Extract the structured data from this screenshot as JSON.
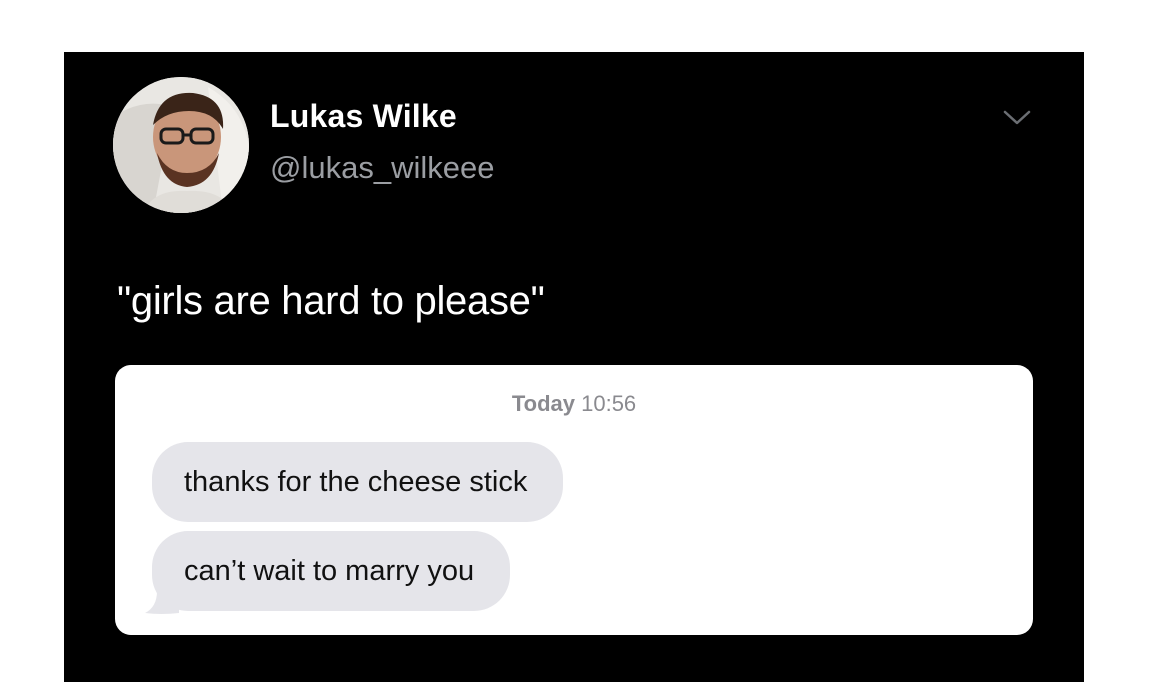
{
  "tweet": {
    "author": {
      "display_name": "Lukas Wilke",
      "handle": "@lukas_wilkeee"
    },
    "text": "\"girls are hard to please\"",
    "menu_icon": "chevron-down-icon"
  },
  "message_screenshot": {
    "timestamp_day": "Today",
    "timestamp_time": "10:56",
    "messages": [
      {
        "text": "thanks for the cheese stick"
      },
      {
        "text": "can’t wait to marry you"
      }
    ],
    "bubble_color": "#e5e5ea"
  },
  "colors": {
    "background": "#000000",
    "name": "#ffffff",
    "handle": "#9b9ea3"
  }
}
